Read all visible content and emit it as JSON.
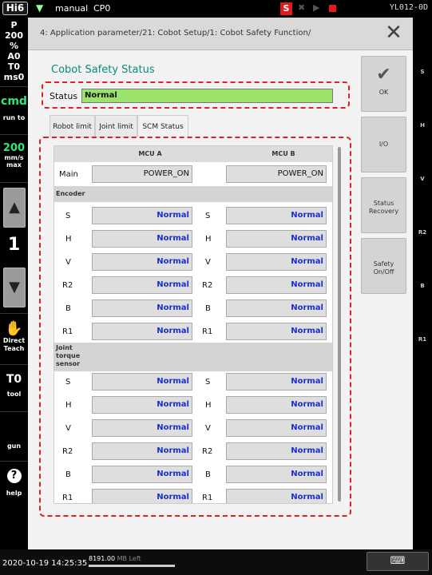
{
  "topbar": {
    "logo": "Hi6",
    "mode": "manual",
    "program": "CP0",
    "servo_badge": "S",
    "robot_id": "YL012-0D"
  },
  "leftpanel": {
    "prog": "P",
    "prog_no": "200",
    "percent": "%",
    "a": "A0",
    "t": "T0",
    "ms": "ms0",
    "cmd": "cmd",
    "run_to": "run to",
    "speed": "200",
    "speed_unit": "mm/s",
    "speed_mode": "max",
    "step": "1",
    "direct_teach_1": "Direct",
    "direct_teach_2": "Teach",
    "tool_num": "T0",
    "tool": "tool",
    "gun": "gun",
    "help": "help"
  },
  "dialog": {
    "breadcrumb": "4: Application parameter/21: Cobot Setup/1: Cobot Safety Function/",
    "title": "Cobot Safety Status",
    "status_label": "Status",
    "status_value": "Normal",
    "tabs": [
      "Robot limit",
      "Joint limit",
      "SCM Status"
    ],
    "mcu_a": "MCU A",
    "mcu_b": "MCU B",
    "main_label": "Main",
    "main_a": "POWER_ON",
    "main_b": "POWER_ON",
    "encoder_title": "Encoder",
    "torque_title_1": "Joint",
    "torque_title_2": "torque",
    "torque_title_3": "sensor",
    "encoder_rows": [
      {
        "axis": "S",
        "a": "Normal",
        "b": "Normal"
      },
      {
        "axis": "H",
        "a": "Normal",
        "b": "Normal"
      },
      {
        "axis": "V",
        "a": "Normal",
        "b": "Normal"
      },
      {
        "axis": "R2",
        "a": "Normal",
        "b": "Normal"
      },
      {
        "axis": "B",
        "a": "Normal",
        "b": "Normal"
      },
      {
        "axis": "R1",
        "a": "Normal",
        "b": "Normal"
      }
    ],
    "torque_rows": [
      {
        "axis": "S",
        "a": "Normal",
        "b": "Normal"
      },
      {
        "axis": "H",
        "a": "Normal",
        "b": "Normal"
      },
      {
        "axis": "V",
        "a": "Normal",
        "b": "Normal"
      },
      {
        "axis": "R2",
        "a": "Normal",
        "b": "Normal"
      },
      {
        "axis": "B",
        "a": "Normal",
        "b": "Normal"
      },
      {
        "axis": "R1",
        "a": "Normal",
        "b": "Normal"
      }
    ]
  },
  "sidebuttons": {
    "ok": "OK",
    "io": "I/O",
    "status_recovery_1": "Status",
    "status_recovery_2": "Recovery",
    "safety_1": "Safety",
    "safety_2": "On/Off"
  },
  "rightstrip": [
    "S",
    "H",
    "V",
    "R2",
    "B",
    "R1"
  ],
  "bottombar": {
    "datetime": "2020-10-19 14:25:35",
    "memory": "8191.00",
    "memory_unit": "MB Left",
    "memory_fraction": 1.0
  },
  "colors": {
    "status_ok": "#9be36a",
    "title": "#0a8a7a",
    "value_text": "#1a2ed2",
    "highlight_border": "#d22222"
  }
}
